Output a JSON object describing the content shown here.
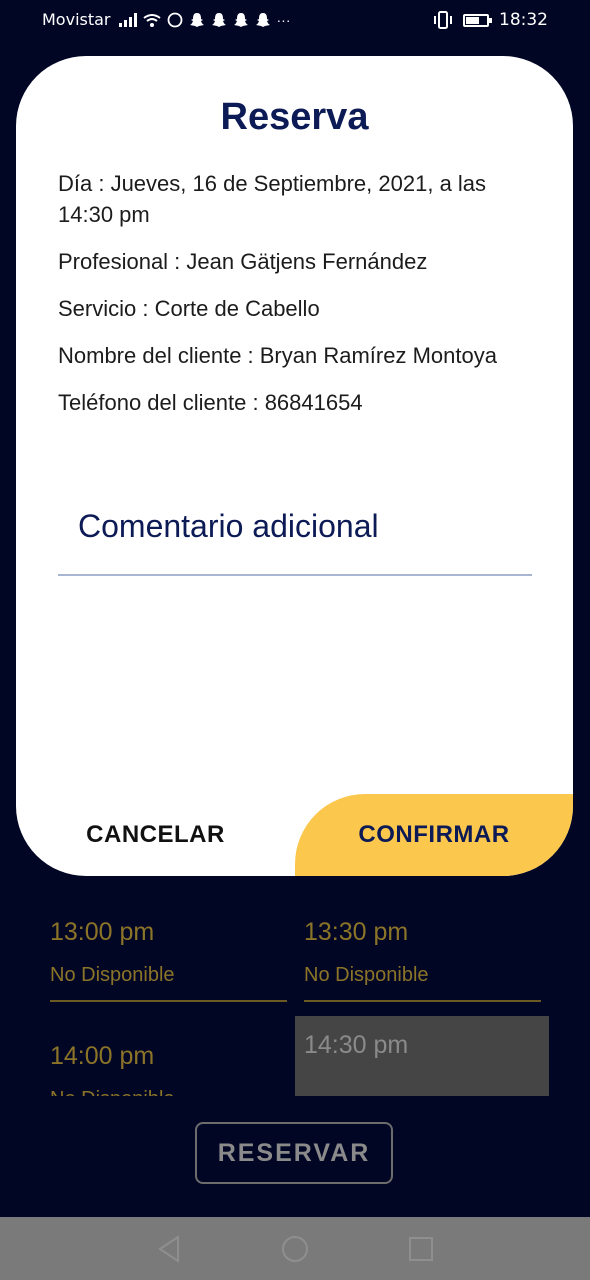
{
  "status_bar": {
    "carrier": "Movistar",
    "clock": "18:32",
    "icons": [
      "signal-icon",
      "wifi-icon",
      "whatsapp-icon",
      "snapchat-icon",
      "snapchat-icon",
      "snapchat-icon",
      "snapchat-icon",
      "more-icon",
      "vibrate-icon",
      "battery-icon"
    ],
    "more": "···"
  },
  "dialog": {
    "title": "Reserva",
    "lines": [
      "Día : Jueves, 16 de Septiembre, 2021, a las 14:30 pm",
      "Profesional : Jean Gätjens Fernández",
      "Servicio : Corte de Cabello",
      "Nombre del cliente : Bryan Ramírez Montoya",
      "Teléfono del cliente : 86841654"
    ],
    "comment_label": "Comentario adicional",
    "cancel_label": "CANCELAR",
    "confirm_label": "CONFIRMAR"
  },
  "slots": [
    {
      "time": "13:00 pm",
      "status": "No Disponible"
    },
    {
      "time": "13:30 pm",
      "status": "No Disponible"
    },
    {
      "time": "14:00 pm",
      "status": "No Disponible"
    },
    {
      "time": "14:30 pm",
      "status": ""
    }
  ],
  "reservar_label": "RESERVAR",
  "colors": {
    "background": "#020625",
    "accent": "#fbc74d",
    "title": "#0c1a55"
  }
}
